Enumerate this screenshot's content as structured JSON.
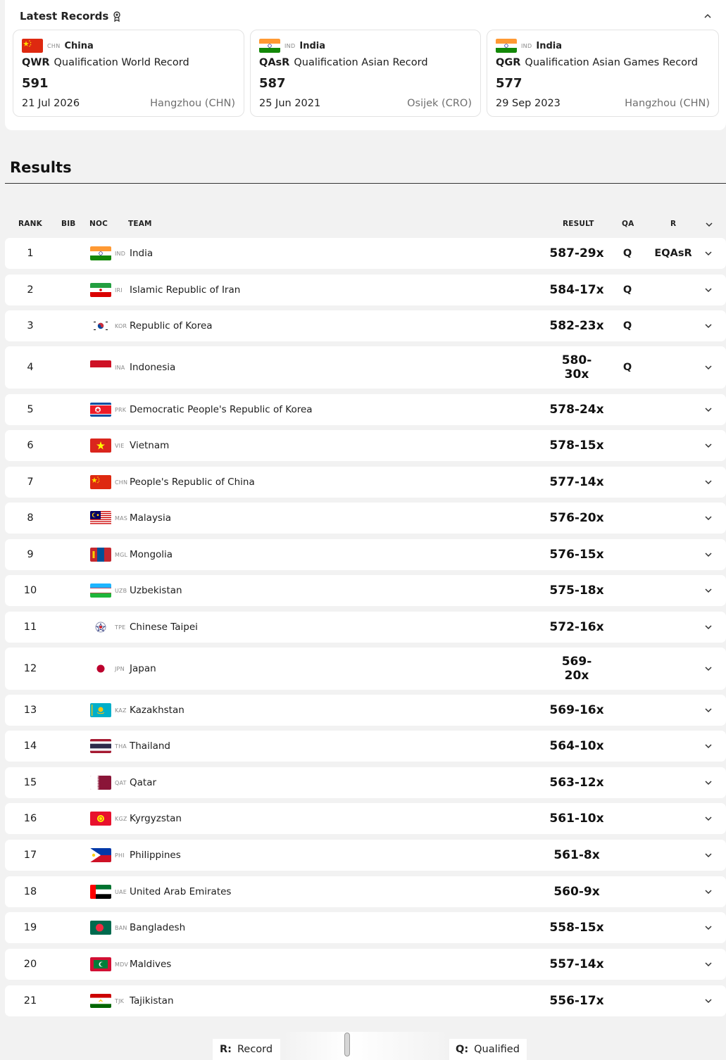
{
  "records": {
    "title": "Latest Records",
    "medal_icon": "medal-icon",
    "collapse_icon": "chevron-up-icon",
    "cards": [
      {
        "noc": "CHN",
        "country": "China",
        "abbr": "QWR",
        "name": "Qualification World Record",
        "score": "591",
        "date": "21 Jul 2026",
        "venue": "Hangzhou (CHN)"
      },
      {
        "noc": "IND",
        "country": "India",
        "abbr": "QAsR",
        "name": "Qualification Asian Record",
        "score": "587",
        "date": "25 Jun 2021",
        "venue": "Osijek (CRO)"
      },
      {
        "noc": "IND",
        "country": "India",
        "abbr": "QGR",
        "name": "Qualification Asian Games Record",
        "score": "577",
        "date": "29 Sep 2023",
        "venue": "Hangzhou (CHN)"
      }
    ]
  },
  "results": {
    "title": "Results",
    "columns": {
      "rank": "RANK",
      "bib": "BIB",
      "noc": "NOC",
      "team": "TEAM",
      "result": "RESULT",
      "qa": "QA",
      "r": "R"
    },
    "expand_icon": "chevron-down-icon",
    "rows": [
      {
        "rank": "1",
        "noc": "IND",
        "team": "India",
        "result": "587-29x",
        "qa": "Q",
        "r": "EQAsR"
      },
      {
        "rank": "2",
        "noc": "IRI",
        "team": "Islamic Republic of Iran",
        "result": "584-17x",
        "qa": "Q",
        "r": ""
      },
      {
        "rank": "3",
        "noc": "KOR",
        "team": "Republic of Korea",
        "result": "582-23x",
        "qa": "Q",
        "r": ""
      },
      {
        "rank": "4",
        "noc": "INA",
        "team": "Indonesia",
        "result": "580-30x",
        "result_wrapped": [
          "580-",
          "30x"
        ],
        "qa": "Q",
        "r": ""
      },
      {
        "rank": "5",
        "noc": "PRK",
        "team": "Democratic People's Republic of Korea",
        "result": "578-24x",
        "qa": "",
        "r": ""
      },
      {
        "rank": "6",
        "noc": "VIE",
        "team": "Vietnam",
        "result": "578-15x",
        "qa": "",
        "r": ""
      },
      {
        "rank": "7",
        "noc": "CHN",
        "team": "People's Republic of China",
        "result": "577-14x",
        "qa": "",
        "r": ""
      },
      {
        "rank": "8",
        "noc": "MAS",
        "team": "Malaysia",
        "result": "576-20x",
        "qa": "",
        "r": ""
      },
      {
        "rank": "9",
        "noc": "MGL",
        "team": "Mongolia",
        "result": "576-15x",
        "qa": "",
        "r": ""
      },
      {
        "rank": "10",
        "noc": "UZB",
        "team": "Uzbekistan",
        "result": "575-18x",
        "qa": "",
        "r": ""
      },
      {
        "rank": "11",
        "noc": "TPE",
        "team": "Chinese Taipei",
        "result": "572-16x",
        "qa": "",
        "r": ""
      },
      {
        "rank": "12",
        "noc": "JPN",
        "team": "Japan",
        "result": "569-20x",
        "result_wrapped": [
          "569-",
          "20x"
        ],
        "qa": "",
        "r": ""
      },
      {
        "rank": "13",
        "noc": "KAZ",
        "team": "Kazakhstan",
        "result": "569-16x",
        "qa": "",
        "r": ""
      },
      {
        "rank": "14",
        "noc": "THA",
        "team": "Thailand",
        "result": "564-10x",
        "qa": "",
        "r": ""
      },
      {
        "rank": "15",
        "noc": "QAT",
        "team": "Qatar",
        "result": "563-12x",
        "qa": "",
        "r": ""
      },
      {
        "rank": "16",
        "noc": "KGZ",
        "team": "Kyrgyzstan",
        "result": "561-10x",
        "qa": "",
        "r": ""
      },
      {
        "rank": "17",
        "noc": "PHI",
        "team": "Philippines",
        "result": "561-8x",
        "qa": "",
        "r": ""
      },
      {
        "rank": "18",
        "noc": "UAE",
        "team": "United Arab Emirates",
        "result": "560-9x",
        "qa": "",
        "r": ""
      },
      {
        "rank": "19",
        "noc": "BAN",
        "team": "Bangladesh",
        "result": "558-15x",
        "qa": "",
        "r": ""
      },
      {
        "rank": "20",
        "noc": "MDV",
        "team": "Maldives",
        "result": "557-14x",
        "qa": "",
        "r": ""
      },
      {
        "rank": "21",
        "noc": "TJK",
        "team": "Tajikistan",
        "result": "556-17x",
        "qa": "",
        "r": ""
      }
    ]
  },
  "legend": {
    "r_key": "R:",
    "r_label": "Record",
    "q_key": "Q:",
    "q_label": "Qualified"
  }
}
